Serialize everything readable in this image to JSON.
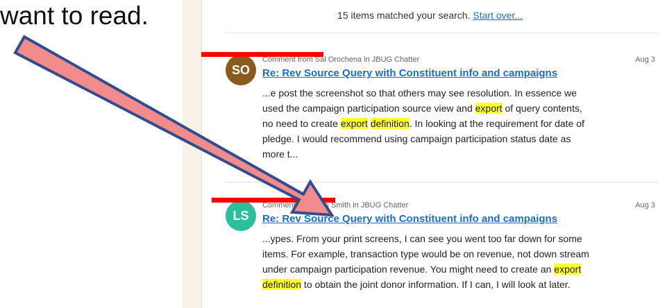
{
  "caption": "want to read.",
  "search": {
    "matched_text": "15 items matched your search.",
    "start_over_label": "Start over..."
  },
  "results": [
    {
      "avatar_initials": "SO",
      "avatar_color": "#8a5a1e",
      "meta": "Comment from Sal Orochena in JBUG Chatter",
      "date": "Aug 3",
      "title": "Re: Rev Source Query with Constituent info and campaigns",
      "snippet_lines": [
        [
          "...e post the screenshot so that others may see resolution. In essence we"
        ],
        [
          "used the campaign participation source view and ",
          {
            "hl": "export"
          },
          " of query contents,"
        ],
        [
          "no need to create ",
          {
            "hl": "export"
          },
          " ",
          {
            "hl": "definition"
          },
          ". In looking at the requirement for date of"
        ],
        [
          "pledge. I would recommend using campaign participation status date as"
        ],
        [
          "more t..."
        ]
      ]
    },
    {
      "avatar_initials": "LS",
      "avatar_color": "#2bbf9b",
      "meta": "Comment from Lois Smith in JBUG Chatter",
      "date": "Aug 3",
      "title": "Re: Rev Source Query with Constituent info and campaigns",
      "snippet_lines": [
        [
          "...ypes. From your print screens, I can see you went too far down for some"
        ],
        [
          "items. For example, transaction type would be on revenue, not down stream"
        ],
        [
          "under campaign participation revenue. You might need to create an ",
          {
            "hl": "export"
          }
        ],
        [
          {
            "hl": "definition"
          },
          " to obtain the joint donor information. If I can, I will look at later."
        ]
      ]
    }
  ],
  "colors": {
    "link": "#1a6fc4",
    "highlight": "#ffff2e",
    "redaction": "#ff0000",
    "arrow_fill": "#f28b8b",
    "arrow_stroke": "#2f4d8f"
  }
}
